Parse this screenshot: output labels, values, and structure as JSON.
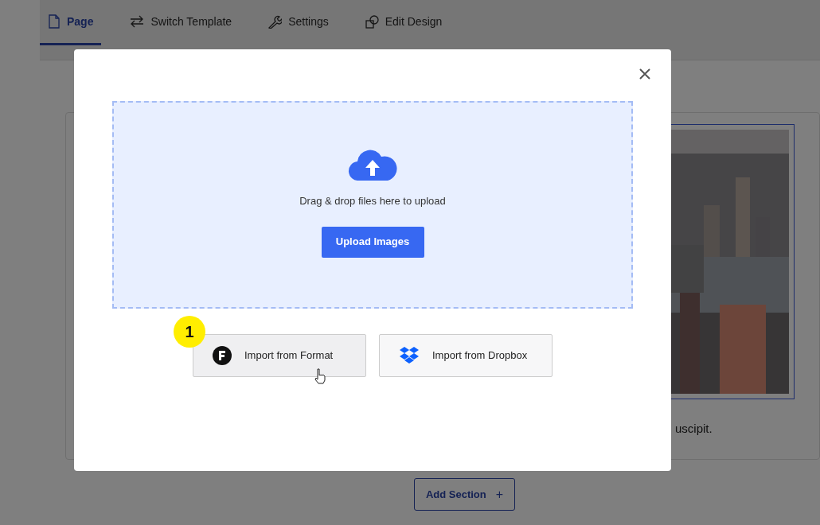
{
  "tabs": [
    {
      "label": "Page",
      "kind": "page",
      "selected": true
    },
    {
      "label": "Switch Template",
      "kind": "switch",
      "selected": false
    },
    {
      "label": "Settings",
      "kind": "wrench",
      "selected": false
    },
    {
      "label": "Edit Design",
      "kind": "shapes",
      "selected": false
    }
  ],
  "content": {
    "text": "uscipit."
  },
  "add_section": {
    "label": "Add Section",
    "icon": "+"
  },
  "modal": {
    "dropzone": {
      "text": "Drag & drop files here to upload",
      "button": "Upload Images"
    },
    "imports": [
      {
        "label": "Import from Format",
        "kind": "format",
        "hovered": true
      },
      {
        "label": "Import from Dropbox",
        "kind": "dropbox",
        "hovered": false
      }
    ],
    "step_badge": "1"
  }
}
